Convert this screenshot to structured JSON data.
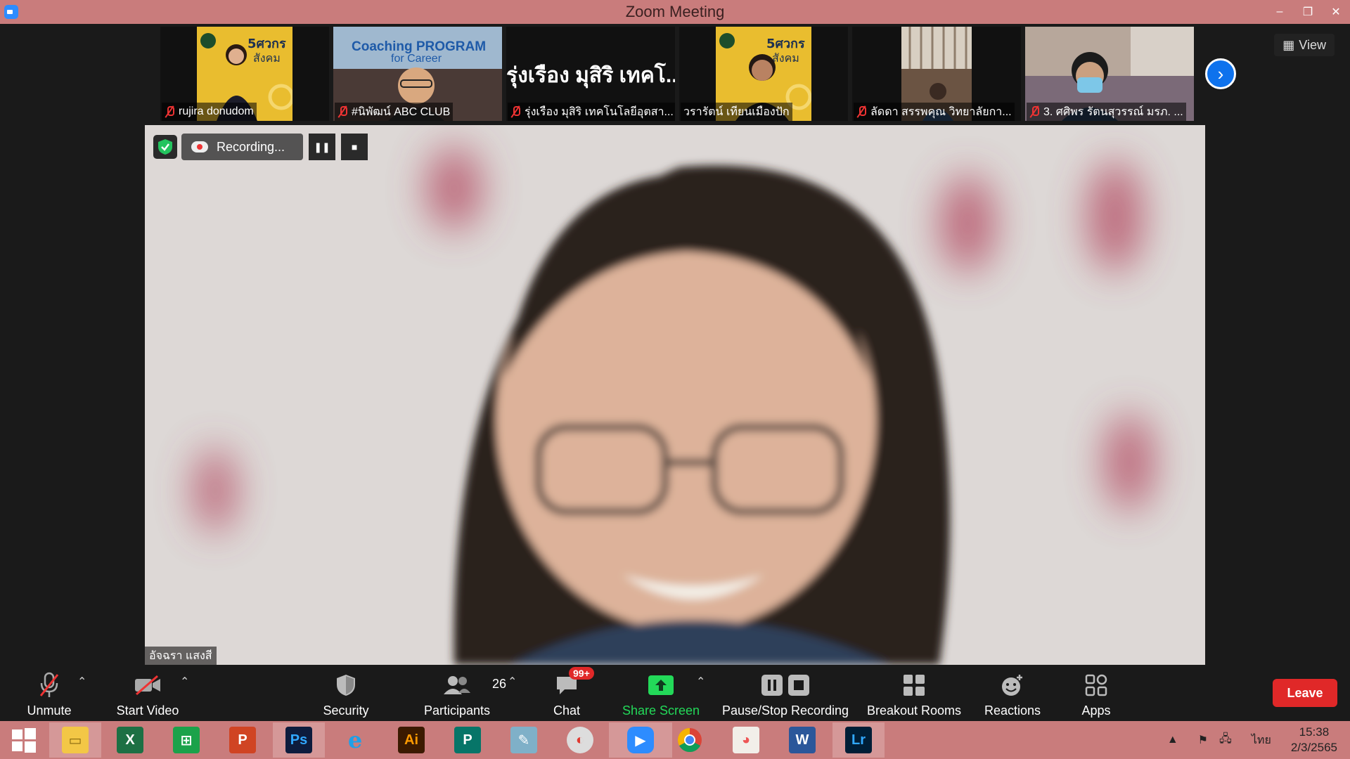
{
  "window": {
    "title": "Zoom Meeting",
    "minimize": "–",
    "restore": "❐",
    "close": "✕"
  },
  "view_button": {
    "label": "View"
  },
  "gallery": {
    "tiles": [
      {
        "name": "rujira donudom",
        "poster_text": "5ศวกร สังคม"
      },
      {
        "name": "#นิพัฒน์ ABC CLUB",
        "poster_text": "Coaching PROGRAM for Career"
      },
      {
        "name": "รุ่งเรือง มุสิริ เทคโนโลยีอุตสา...",
        "display_name": "รุ่งเรือง มุสิริ เทคโ..."
      },
      {
        "name": "วรารัตน์ เทียนเมืองปัก",
        "poster_text": "5ศวกร สังคม"
      },
      {
        "name": "ลัดดา สรรพคุณ วิทยาลัยกา..."
      },
      {
        "name": "3. ศศิพร รัตนสุวรรณ์ มรภ. ..."
      }
    ],
    "next_icon": "chevron-right-icon"
  },
  "recording": {
    "label": "Recording...",
    "pause_icon": "pause-icon",
    "stop_icon": "stop-icon"
  },
  "main_speaker": {
    "name": "อัจฉรา แสงสี"
  },
  "toolbar": {
    "unmute": "Unmute",
    "start_video": "Start Video",
    "security": "Security",
    "participants": "Participants",
    "participants_count": "26",
    "chat": "Chat",
    "chat_badge": "99+",
    "share_screen": "Share Screen",
    "pause_stop_recording": "Pause/Stop Recording",
    "breakout_rooms": "Breakout Rooms",
    "reactions": "Reactions",
    "apps": "Apps",
    "leave": "Leave"
  },
  "taskbar": {
    "apps": [
      "Windows Start",
      "File Explorer",
      "Excel",
      "Store",
      "PowerPoint",
      "Ps",
      "Internet Explorer",
      "Ai",
      "Publisher",
      "Pen",
      "Photoscape",
      "Zoom",
      "Chrome",
      "Paint",
      "Word",
      "Lr"
    ],
    "language": "ไทย",
    "time": "15:38",
    "date": "2/3/2565"
  },
  "colors": {
    "titlebar": "#c97c7c",
    "leave": "#e02828",
    "share_green": "#23d959",
    "accent_blue": "#0e72ed"
  }
}
